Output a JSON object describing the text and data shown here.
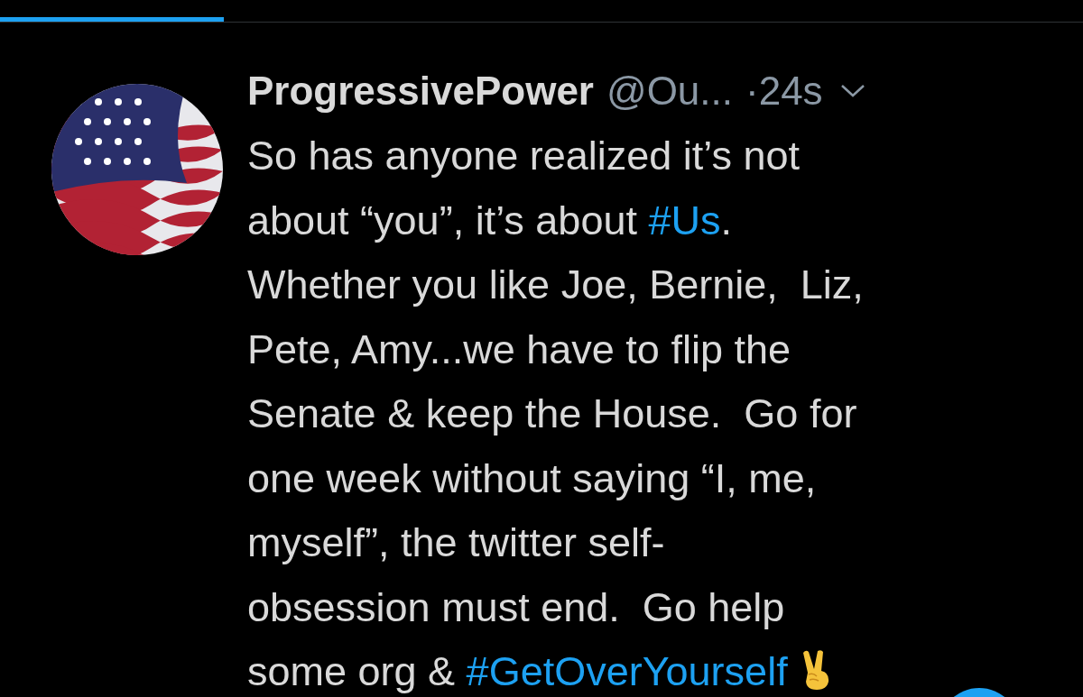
{
  "tabs": [
    {
      "kind": "indicator",
      "selected": true
    }
  ],
  "tweet": {
    "name": "ProgressivePower",
    "handle": "@Ou...",
    "time": "·24s",
    "body": [
      {
        "kind": "text",
        "text": "So has anyone realized it’s not\nabout “you”, it’s about "
      },
      {
        "kind": "hashtag",
        "text": "#Us"
      },
      {
        "kind": "text",
        "text": ".\nWhether you like Joe, Bernie,  Liz,\nPete, Amy...we have to flip the\nSenate & keep the House.  Go for\none week without saying “I, me,\nmyself”, the twitter self-\nobsession must end.  Go help\nsome org & "
      },
      {
        "kind": "hashtag",
        "text": "#GetOverYourself"
      },
      {
        "kind": "emoji"
      }
    ]
  }
}
